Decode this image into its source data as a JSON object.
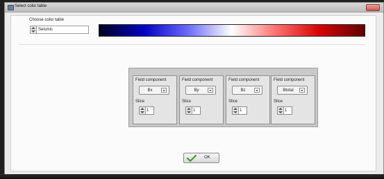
{
  "window": {
    "title": "Select color table"
  },
  "color_table": {
    "label": "Choose color table",
    "selected": "Seismic",
    "colormap_stops": [
      "#000020",
      "#0000c0",
      "#6a6aff",
      "#ffffff",
      "#ff7070",
      "#d40000",
      "#600000"
    ]
  },
  "panels": [
    {
      "field_label": "Field component",
      "field_value": "Bx",
      "slice_label": "Slice",
      "slice_value": "1"
    },
    {
      "field_label": "Field component",
      "field_value": "By",
      "slice_label": "Slice",
      "slice_value": "1"
    },
    {
      "field_label": "Field component",
      "field_value": "Bz",
      "slice_label": "Slice",
      "slice_value": "1"
    },
    {
      "field_label": "Field component",
      "field_value": "Btotal",
      "slice_label": "Slice",
      "slice_value": "1"
    }
  ],
  "ok_button": {
    "label": "OK"
  },
  "colors": {
    "ok_check": "#3f9a2e"
  }
}
